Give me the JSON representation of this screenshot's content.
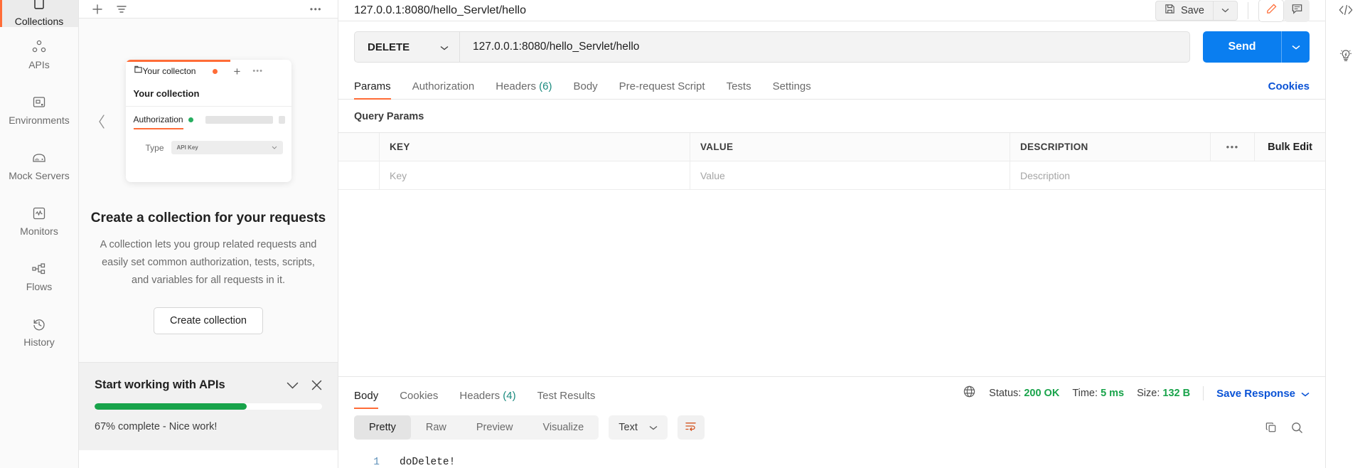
{
  "rail": {
    "items": [
      {
        "label": "Collections",
        "icon": "collections-icon",
        "active": true
      },
      {
        "label": "APIs",
        "icon": "apis-icon",
        "active": false
      },
      {
        "label": "Environments",
        "icon": "environments-icon",
        "active": false
      },
      {
        "label": "Mock Servers",
        "icon": "mock-servers-icon",
        "active": false
      },
      {
        "label": "Monitors",
        "icon": "monitors-icon",
        "active": false
      },
      {
        "label": "Flows",
        "icon": "flows-icon",
        "active": false
      },
      {
        "label": "History",
        "icon": "history-icon",
        "active": false
      }
    ]
  },
  "sidebar": {
    "toolbar": {
      "new_label": "+",
      "filter_label": "filter-icon",
      "more_label": "•••"
    },
    "preview_card": {
      "tab_label": "Your collecton",
      "tab_plus": "+",
      "tab_more": "•••",
      "title": "Your collection",
      "auth_tab": "Authorization",
      "type_label": "Type",
      "type_value": "API Key"
    },
    "empty_state": {
      "title": "Create a collection for your requests",
      "description": "A collection lets you group related requests and easily set common authorization, tests, scripts, and variables for all requests in it.",
      "button": "Create collection"
    },
    "progress": {
      "title": "Start working with APIs",
      "percent": 67,
      "status": "67% complete - Nice work!",
      "bar_color": "#18a34a"
    }
  },
  "request": {
    "title": "127.0.0.1:8080/hello_Servlet/hello",
    "save_label": "Save",
    "method": "DELETE",
    "url": "127.0.0.1:8080/hello_Servlet/hello",
    "send_label": "Send",
    "send_color": "#0a7ef0",
    "tabs": [
      {
        "label": "Params",
        "count": "",
        "active": true
      },
      {
        "label": "Authorization",
        "count": "",
        "active": false
      },
      {
        "label": "Headers",
        "count": "(6)",
        "active": false
      },
      {
        "label": "Body",
        "count": "",
        "active": false
      },
      {
        "label": "Pre-request Script",
        "count": "",
        "active": false
      },
      {
        "label": "Tests",
        "count": "",
        "active": false
      },
      {
        "label": "Settings",
        "count": "",
        "active": false
      }
    ],
    "cookies_label": "Cookies",
    "query_params_label": "Query Params",
    "table": {
      "headers": [
        "KEY",
        "VALUE",
        "DESCRIPTION"
      ],
      "more_label": "•••",
      "bulk_edit_label": "Bulk Edit",
      "rows": [
        {
          "key": "Key",
          "value": "Value",
          "description": "Description"
        }
      ]
    }
  },
  "response": {
    "tabs": [
      {
        "label": "Body",
        "count": "",
        "active": true
      },
      {
        "label": "Cookies",
        "count": "",
        "active": false
      },
      {
        "label": "Headers",
        "count": "(4)",
        "active": false
      },
      {
        "label": "Test Results",
        "count": "",
        "active": false
      }
    ],
    "status_label": "Status:",
    "status_value": "200 OK",
    "time_label": "Time:",
    "time_value": "5 ms",
    "size_label": "Size:",
    "size_value": "132 B",
    "save_response_label": "Save Response",
    "view_modes": [
      {
        "label": "Pretty",
        "active": true
      },
      {
        "label": "Raw",
        "active": false
      },
      {
        "label": "Preview",
        "active": false
      },
      {
        "label": "Visualize",
        "active": false
      }
    ],
    "format": "Text",
    "body_lines": [
      {
        "num": "1",
        "text": "doDelete!"
      }
    ]
  },
  "right_rail": {
    "items": [
      {
        "icon": "code-icon"
      },
      {
        "icon": "lightbulb-icon"
      }
    ]
  },
  "colors": {
    "accent": "#ff6c37",
    "link": "#0a53d6",
    "success": "#18a34a",
    "primary": "#0a7ef0"
  }
}
